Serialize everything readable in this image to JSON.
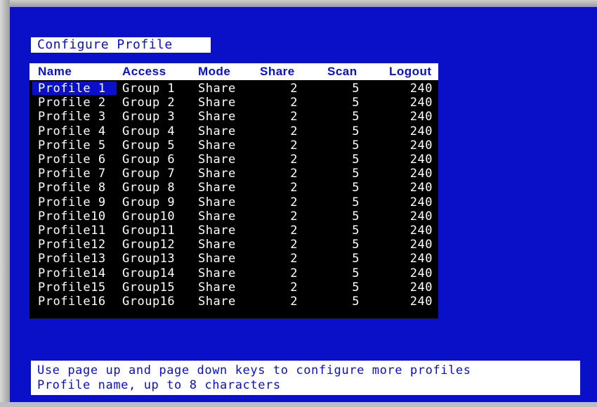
{
  "title": "Configure Profile",
  "table": {
    "headers": {
      "name": "Name",
      "access": "Access",
      "mode": "Mode",
      "share": "Share",
      "scan": "Scan",
      "logout": "Logout"
    },
    "selected_index": 0,
    "rows": [
      {
        "name": "Profile 1",
        "access": "Group 1",
        "mode": "Share",
        "share": "2",
        "scan": "5",
        "logout": "240"
      },
      {
        "name": "Profile 2",
        "access": "Group 2",
        "mode": "Share",
        "share": "2",
        "scan": "5",
        "logout": "240"
      },
      {
        "name": "Profile 3",
        "access": "Group 3",
        "mode": "Share",
        "share": "2",
        "scan": "5",
        "logout": "240"
      },
      {
        "name": "Profile 4",
        "access": "Group 4",
        "mode": "Share",
        "share": "2",
        "scan": "5",
        "logout": "240"
      },
      {
        "name": "Profile 5",
        "access": "Group 5",
        "mode": "Share",
        "share": "2",
        "scan": "5",
        "logout": "240"
      },
      {
        "name": "Profile 6",
        "access": "Group 6",
        "mode": "Share",
        "share": "2",
        "scan": "5",
        "logout": "240"
      },
      {
        "name": "Profile 7",
        "access": "Group 7",
        "mode": "Share",
        "share": "2",
        "scan": "5",
        "logout": "240"
      },
      {
        "name": "Profile 8",
        "access": "Group 8",
        "mode": "Share",
        "share": "2",
        "scan": "5",
        "logout": "240"
      },
      {
        "name": "Profile 9",
        "access": "Group 9",
        "mode": "Share",
        "share": "2",
        "scan": "5",
        "logout": "240"
      },
      {
        "name": "Profile10",
        "access": "Group10",
        "mode": "Share",
        "share": "2",
        "scan": "5",
        "logout": "240"
      },
      {
        "name": "Profile11",
        "access": "Group11",
        "mode": "Share",
        "share": "2",
        "scan": "5",
        "logout": "240"
      },
      {
        "name": "Profile12",
        "access": "Group12",
        "mode": "Share",
        "share": "2",
        "scan": "5",
        "logout": "240"
      },
      {
        "name": "Profile13",
        "access": "Group13",
        "mode": "Share",
        "share": "2",
        "scan": "5",
        "logout": "240"
      },
      {
        "name": "Profile14",
        "access": "Group14",
        "mode": "Share",
        "share": "2",
        "scan": "5",
        "logout": "240"
      },
      {
        "name": "Profile15",
        "access": "Group15",
        "mode": "Share",
        "share": "2",
        "scan": "5",
        "logout": "240"
      },
      {
        "name": "Profile16",
        "access": "Group16",
        "mode": "Share",
        "share": "2",
        "scan": "5",
        "logout": "240"
      }
    ]
  },
  "help": {
    "line1": "Use page up and page down keys to configure more profiles",
    "line2": "Profile name, up to 8 characters"
  },
  "colors": {
    "screen_bg": "#0a10c8",
    "table_bg": "#000000",
    "text_light": "#ffffff",
    "text_accent": "#0a10c8",
    "selection_bg": "#0a10c8"
  }
}
